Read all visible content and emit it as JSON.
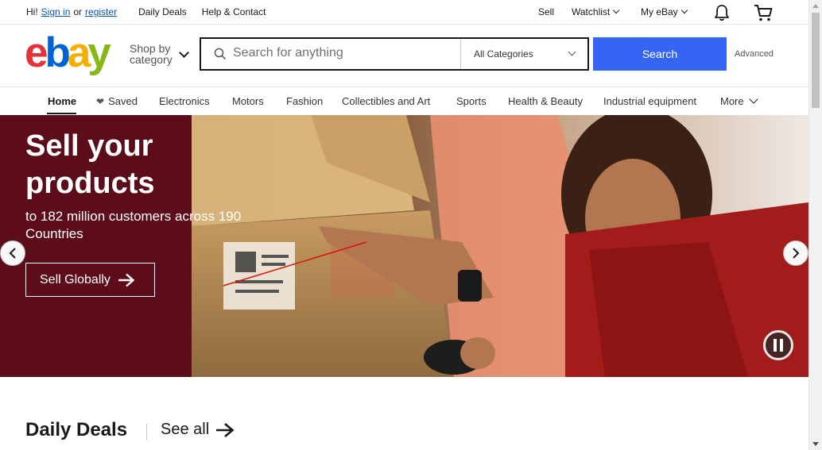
{
  "topbar": {
    "greeting": "Hi!",
    "sign_in": "Sign in",
    "or": "or",
    "register": "register",
    "daily_deals": "Daily Deals",
    "help_contact": "Help & Contact",
    "sell": "Sell",
    "watchlist": "Watchlist",
    "my_ebay": "My eBay"
  },
  "header": {
    "logo": {
      "e": "e",
      "b": "b",
      "a": "a",
      "y": "y"
    },
    "shop_by_line1": "Shop by",
    "shop_by_line2": "category",
    "search_placeholder": "Search for anything",
    "category_selected": "All Categories",
    "search_button": "Search",
    "advanced": "Advanced"
  },
  "nav": {
    "items": [
      "Home",
      "Saved",
      "Electronics",
      "Motors",
      "Fashion",
      "Collectibles and Art",
      "Sports",
      "Health & Beauty",
      "Industrial equipment",
      "More"
    ]
  },
  "hero": {
    "title_line1": "Sell your",
    "title_line2": "products",
    "subtitle": "to 182 million customers across 190 Countries",
    "cta": "Sell Globally"
  },
  "deals": {
    "title": "Daily Deals",
    "see_all": "See all"
  },
  "colors": {
    "brand_red": "#e53238",
    "brand_blue": "#0064d2",
    "brand_yellow": "#f5af02",
    "brand_green": "#86b817",
    "search_button": "#3665f3",
    "hero_panel": "#5c0d19"
  }
}
